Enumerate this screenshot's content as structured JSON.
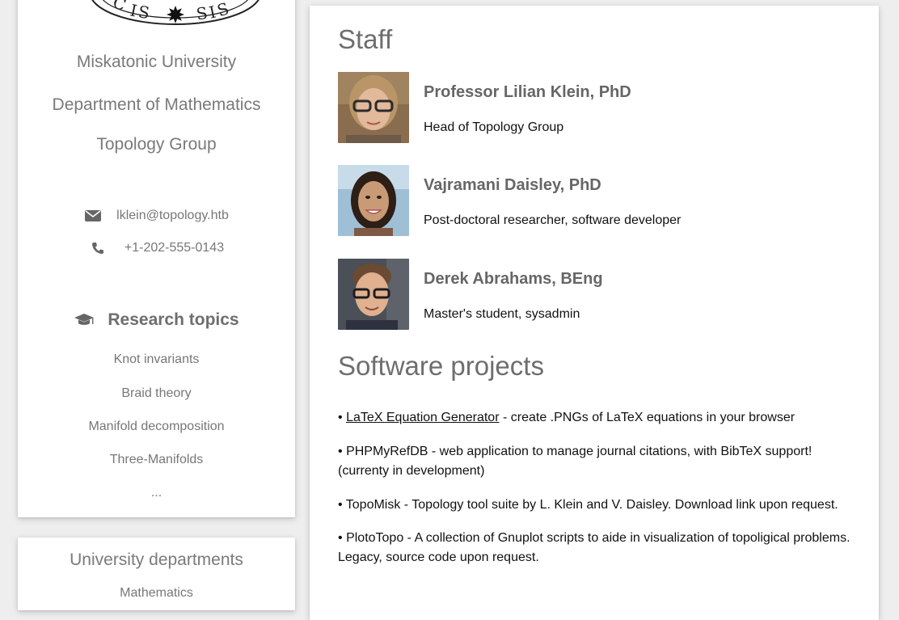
{
  "sidebar": {
    "logo_text": "SICIS",
    "org_name": "Miskatonic University",
    "department": "Department of Mathematics",
    "group": "Topology Group",
    "email": "lklein@topology.htb",
    "phone": "+1-202-555-0143",
    "research_title": "Research topics",
    "topics": [
      "Knot invariants",
      "Braid theory",
      "Manifold decomposition",
      "Three-Manifolds",
      "..."
    ]
  },
  "departments": {
    "title": "University departments",
    "items": [
      "Mathematics"
    ]
  },
  "main": {
    "staff_title": "Staff",
    "staff": [
      {
        "name": "Professor Lilian Klein, PhD",
        "role": "Head of Topology Group"
      },
      {
        "name": "Vajramani Daisley, PhD",
        "role": "Post-doctoral researcher, software developer"
      },
      {
        "name": "Derek Abrahams, BEng",
        "role": "Master's student, sysadmin"
      }
    ],
    "projects_title": "Software projects",
    "projects": [
      {
        "bullet": "•",
        "link": "LaTeX Equation Generator",
        "text": " - create .PNGs of LaTeX equations in your browser"
      },
      {
        "bullet": "•",
        "link": "",
        "text": "PHPMyRefDB - web application to manage journal citations, with BibTeX support! (currenty in development)"
      },
      {
        "bullet": "•",
        "link": "",
        "text": "TopoMisk - Topology tool suite by L. Klein and V. Daisley. Download link upon request."
      },
      {
        "bullet": "•",
        "link": "",
        "text": "PlotoTopo - A collection of Gnuplot scripts to aide in visualization of topoligical problems. Legacy, source code upon request."
      }
    ]
  },
  "icons": {
    "email": "envelope-icon",
    "phone": "phone-icon",
    "research": "graduation-cap-icon"
  },
  "colors": {
    "background": "#eeeeee",
    "card": "#ffffff",
    "heading_text": "#6e6e6e",
    "muted_text": "#777777"
  }
}
